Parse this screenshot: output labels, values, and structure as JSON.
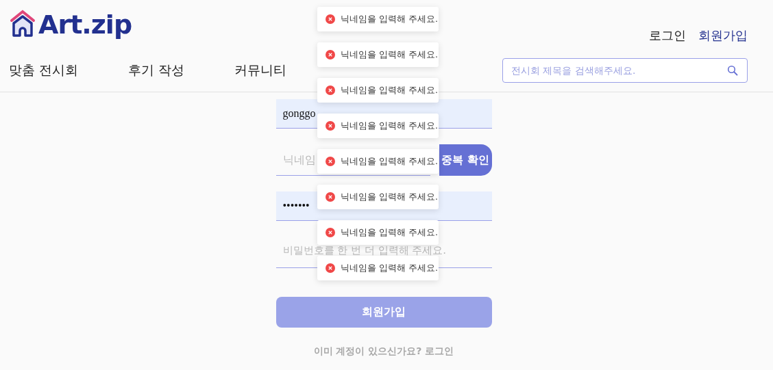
{
  "header": {
    "logo": "Art.zip",
    "auth_links": [
      {
        "label": "로그인",
        "selected": false
      },
      {
        "label": "회원가입",
        "selected": true
      }
    ],
    "nav": [
      "맞춤 전시회",
      "후기 작성",
      "커뮤니티"
    ],
    "search": {
      "placeholder": "전시회 제목을 검색해주세요."
    }
  },
  "form": {
    "email": {
      "value": "gonggo"
    },
    "nickname": {
      "placeholder": "닉네임"
    },
    "check_button": "중복 확인",
    "password": {
      "value": "•••••••"
    },
    "password_confirm": {
      "placeholder": "비밀번호를 한 번 더 입력해 주세요."
    },
    "submit_button": "회원가입",
    "login_link": "이미 계정이 있으신가요? 로그인"
  },
  "toasts": [
    {
      "message": "닉네임을 입력해 주세요."
    },
    {
      "message": "닉네임을 입력해 주세요."
    },
    {
      "message": "닉네임을 입력해 주세요."
    },
    {
      "message": "닉네임을 입력해 주세요."
    },
    {
      "message": "닉네임을 입력해 주세요."
    },
    {
      "message": "닉네임을 입력해 주세요."
    },
    {
      "message": "닉네임을 입력해 주세요."
    },
    {
      "message": "닉네임을 입력해 주세요."
    }
  ]
}
